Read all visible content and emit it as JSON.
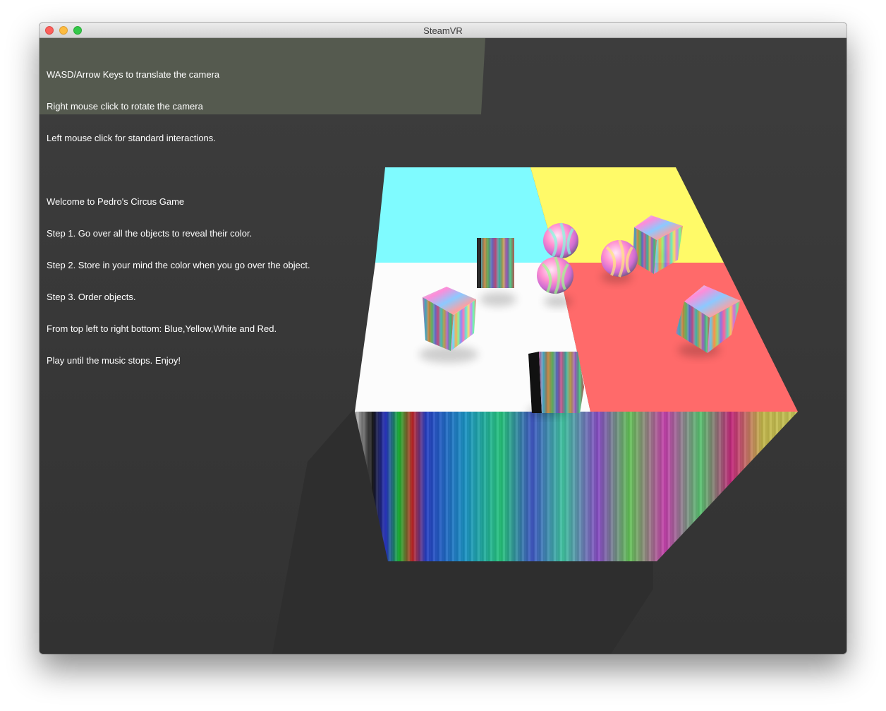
{
  "window": {
    "title": "SteamVR"
  },
  "instructions": {
    "lines": [
      "WASD/Arrow Keys to translate the camera",
      "Right mouse click to rotate the camera",
      "Left mouse click for standard interactions.",
      "",
      "Welcome to Pedro's Circus Game",
      "Step 1. Go over all the objects to reveal their color.",
      "Step 2. Store in your mind the color when you go over the object.",
      "Step 3. Order objects.",
      "From top left to right bottom: Blue,Yellow,White and Red.",
      "Play until the music stops. Enjoy!"
    ]
  },
  "scene": {
    "background_color": "#3a3a3a",
    "floor_quadrants": [
      {
        "name": "top-left",
        "color": "#7ffbff"
      },
      {
        "name": "top-right",
        "color": "#fffa68"
      },
      {
        "name": "bottom-left",
        "color": "#fcfcfc"
      },
      {
        "name": "bottom-right",
        "color": "#ff6a6a"
      }
    ],
    "object_counts": {
      "cubes": 5,
      "spheres": 3
    }
  }
}
